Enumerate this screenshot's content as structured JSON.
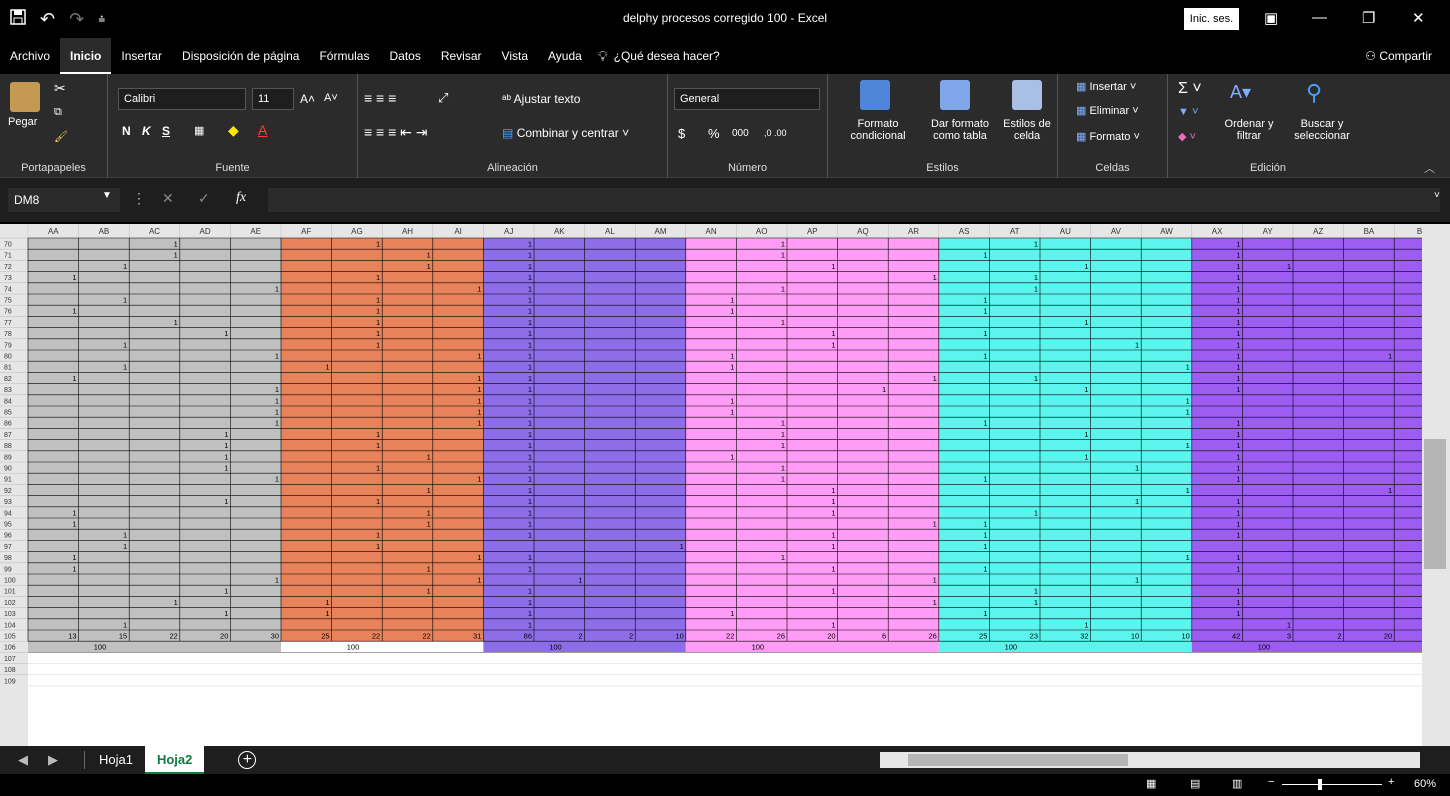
{
  "window": {
    "title": "delphy procesos corregido 100  -  Excel",
    "signin_label": "Inic. ses.",
    "quick_access": [
      "save-icon",
      "undo-icon",
      "redo-icon",
      "customize-icon"
    ]
  },
  "menu": {
    "items": [
      "Archivo",
      "Inicio",
      "Insertar",
      "Disposición de página",
      "Fórmulas",
      "Datos",
      "Revisar",
      "Vista",
      "Ayuda"
    ],
    "active": "Inicio",
    "tell_me": "¿Qué desea hacer?",
    "share": "Compartir"
  },
  "ribbon": {
    "clipboard": {
      "paste": "Pegar",
      "label": "Portapapeles"
    },
    "font": {
      "name": "Calibri",
      "size": "11",
      "bold": "N",
      "italic": "K",
      "underline": "S",
      "label": "Fuente"
    },
    "alignment": {
      "wrap": "Ajustar texto",
      "merge": "Combinar y centrar",
      "label": "Alineación"
    },
    "number": {
      "format": "General",
      "currency": "$",
      "percent": "%",
      "thousands": "000",
      "inc_dec": ",0 .00",
      "dec_dec": ",00 →,0",
      "label": "Número"
    },
    "styles": {
      "conditional": "Formato condicional",
      "table": "Dar formato como tabla",
      "cell": "Estilos de celda",
      "label": "Estilos"
    },
    "cells": {
      "insert": "Insertar",
      "delete": "Eliminar",
      "format": "Formato",
      "label": "Celdas"
    },
    "editing": {
      "sort": "Ordenar y filtrar",
      "find": "Buscar y seleccionar",
      "label": "Edición"
    }
  },
  "formula_bar": {
    "name_box": "DM8",
    "formula": "",
    "fx": "fx"
  },
  "sheet": {
    "columns": [
      "AA",
      "AB",
      "AC",
      "AD",
      "AE",
      "AF",
      "AG",
      "AH",
      "AI",
      "AJ",
      "AK",
      "AL",
      "AM",
      "AN",
      "AO",
      "AP",
      "AQ",
      "AR",
      "AS",
      "AT",
      "AU",
      "AV",
      "AW",
      "AX",
      "AY",
      "AZ",
      "BA",
      "B"
    ],
    "rows": [
      "70",
      "71",
      "72",
      "73",
      "74",
      "75",
      "76",
      "77",
      "78",
      "79",
      "80",
      "81",
      "82",
      "83",
      "84",
      "85",
      "86",
      "87",
      "88",
      "89",
      "90",
      "91",
      "92",
      "93",
      "94",
      "95",
      "96",
      "97",
      "98",
      "99",
      "100",
      "101",
      "102",
      "103",
      "104",
      "105",
      "106",
      "107",
      "108",
      "109"
    ],
    "group_colors": [
      "#c0c0c0",
      "#e8825a",
      "#8e6ee8",
      "#ff9cf5",
      "#5bf5ee",
      "#9d5cf2"
    ],
    "matrix": [
      [
        0,
        0,
        1,
        0,
        0,
        0,
        1,
        0,
        0,
        1,
        0,
        0,
        0,
        0,
        1,
        0,
        0,
        0,
        0,
        1,
        0,
        0,
        0,
        1,
        0,
        0,
        0,
        0
      ],
      [
        0,
        0,
        1,
        0,
        0,
        0,
        0,
        1,
        0,
        1,
        0,
        0,
        0,
        0,
        1,
        0,
        0,
        0,
        1,
        0,
        0,
        0,
        0,
        1,
        0,
        0,
        0,
        0
      ],
      [
        0,
        1,
        0,
        0,
        0,
        0,
        0,
        1,
        0,
        1,
        0,
        0,
        0,
        0,
        0,
        1,
        0,
        0,
        0,
        0,
        1,
        0,
        0,
        1,
        1,
        0,
        0,
        0
      ],
      [
        1,
        0,
        0,
        0,
        0,
        0,
        1,
        0,
        0,
        1,
        0,
        0,
        0,
        0,
        0,
        0,
        0,
        1,
        0,
        1,
        0,
        0,
        0,
        1,
        0,
        0,
        0,
        0
      ],
      [
        0,
        0,
        0,
        0,
        1,
        0,
        0,
        0,
        1,
        1,
        0,
        0,
        0,
        0,
        1,
        0,
        0,
        0,
        0,
        1,
        0,
        0,
        0,
        1,
        0,
        0,
        0,
        0
      ],
      [
        0,
        1,
        0,
        0,
        0,
        0,
        1,
        0,
        0,
        1,
        0,
        0,
        0,
        1,
        0,
        0,
        0,
        0,
        1,
        0,
        0,
        0,
        0,
        1,
        0,
        0,
        0,
        0
      ],
      [
        1,
        0,
        0,
        0,
        0,
        0,
        1,
        0,
        0,
        1,
        0,
        0,
        0,
        1,
        0,
        0,
        0,
        0,
        1,
        0,
        0,
        0,
        0,
        1,
        0,
        0,
        0,
        0
      ],
      [
        0,
        0,
        1,
        0,
        0,
        0,
        1,
        0,
        0,
        1,
        0,
        0,
        0,
        0,
        1,
        0,
        0,
        0,
        0,
        0,
        1,
        0,
        0,
        1,
        0,
        0,
        0,
        0
      ],
      [
        0,
        0,
        0,
        1,
        0,
        0,
        1,
        0,
        0,
        1,
        0,
        0,
        0,
        0,
        0,
        1,
        0,
        0,
        1,
        0,
        0,
        0,
        0,
        1,
        0,
        0,
        0,
        0
      ],
      [
        0,
        1,
        0,
        0,
        0,
        0,
        1,
        0,
        0,
        1,
        0,
        0,
        0,
        0,
        0,
        1,
        0,
        0,
        0,
        0,
        0,
        1,
        0,
        1,
        0,
        0,
        0,
        0
      ],
      [
        0,
        0,
        0,
        0,
        1,
        0,
        0,
        0,
        1,
        1,
        0,
        0,
        0,
        1,
        0,
        0,
        0,
        0,
        1,
        0,
        0,
        0,
        0,
        1,
        0,
        0,
        1,
        0
      ],
      [
        0,
        1,
        0,
        0,
        0,
        1,
        0,
        0,
        0,
        1,
        0,
        0,
        0,
        1,
        0,
        0,
        0,
        0,
        0,
        0,
        0,
        0,
        1,
        1,
        0,
        0,
        0,
        0
      ],
      [
        1,
        0,
        0,
        0,
        0,
        0,
        0,
        0,
        1,
        1,
        0,
        0,
        0,
        0,
        0,
        0,
        0,
        1,
        0,
        1,
        0,
        0,
        0,
        1,
        0,
        0,
        0,
        0
      ],
      [
        0,
        0,
        0,
        0,
        1,
        0,
        0,
        0,
        1,
        1,
        0,
        0,
        0,
        0,
        0,
        0,
        1,
        0,
        0,
        0,
        1,
        0,
        0,
        1,
        0,
        0,
        0,
        0
      ],
      [
        0,
        0,
        0,
        0,
        1,
        0,
        0,
        0,
        1,
        1,
        0,
        0,
        0,
        1,
        0,
        0,
        0,
        0,
        0,
        0,
        0,
        0,
        1,
        0,
        0,
        0,
        0,
        0
      ],
      [
        0,
        0,
        0,
        0,
        1,
        0,
        0,
        0,
        1,
        1,
        0,
        0,
        0,
        1,
        0,
        0,
        0,
        0,
        0,
        0,
        0,
        0,
        1,
        0,
        0,
        0,
        0,
        0
      ],
      [
        0,
        0,
        0,
        0,
        1,
        0,
        0,
        0,
        1,
        1,
        0,
        0,
        0,
        0,
        1,
        0,
        0,
        0,
        1,
        0,
        0,
        0,
        0,
        1,
        0,
        0,
        0,
        0
      ],
      [
        0,
        0,
        0,
        1,
        0,
        0,
        1,
        0,
        0,
        1,
        0,
        0,
        0,
        0,
        1,
        0,
        0,
        0,
        0,
        0,
        1,
        0,
        0,
        1,
        0,
        0,
        0,
        0
      ],
      [
        0,
        0,
        0,
        1,
        0,
        0,
        1,
        0,
        0,
        1,
        0,
        0,
        0,
        0,
        1,
        0,
        0,
        0,
        0,
        0,
        0,
        0,
        1,
        1,
        0,
        0,
        0,
        0
      ],
      [
        0,
        0,
        0,
        1,
        0,
        0,
        0,
        1,
        0,
        1,
        0,
        0,
        0,
        1,
        0,
        0,
        0,
        0,
        0,
        0,
        1,
        0,
        0,
        1,
        0,
        0,
        0,
        0
      ],
      [
        0,
        0,
        0,
        1,
        0,
        0,
        1,
        0,
        0,
        1,
        0,
        0,
        0,
        0,
        1,
        0,
        0,
        0,
        0,
        0,
        0,
        1,
        0,
        1,
        0,
        0,
        0,
        0
      ],
      [
        0,
        0,
        0,
        0,
        1,
        0,
        0,
        0,
        1,
        1,
        0,
        0,
        0,
        0,
        1,
        0,
        0,
        0,
        1,
        0,
        0,
        0,
        0,
        1,
        0,
        0,
        0,
        0
      ],
      [
        0,
        0,
        0,
        0,
        0,
        0,
        0,
        1,
        0,
        1,
        0,
        0,
        0,
        0,
        0,
        1,
        0,
        0,
        0,
        0,
        0,
        0,
        1,
        0,
        0,
        0,
        1,
        0
      ],
      [
        0,
        0,
        0,
        1,
        0,
        0,
        1,
        0,
        0,
        1,
        0,
        0,
        0,
        0,
        0,
        1,
        0,
        0,
        0,
        0,
        0,
        1,
        0,
        1,
        0,
        0,
        0,
        0
      ],
      [
        1,
        0,
        0,
        0,
        0,
        0,
        0,
        1,
        0,
        1,
        0,
        0,
        0,
        0,
        0,
        1,
        0,
        0,
        0,
        1,
        0,
        0,
        0,
        1,
        0,
        0,
        0,
        0
      ],
      [
        1,
        0,
        0,
        0,
        0,
        0,
        0,
        1,
        0,
        1,
        0,
        0,
        0,
        0,
        0,
        0,
        0,
        1,
        1,
        0,
        0,
        0,
        0,
        1,
        0,
        0,
        0,
        0
      ],
      [
        0,
        1,
        0,
        0,
        0,
        0,
        1,
        0,
        0,
        1,
        0,
        0,
        0,
        0,
        0,
        1,
        0,
        0,
        1,
        0,
        0,
        0,
        0,
        1,
        0,
        0,
        0,
        0
      ],
      [
        0,
        1,
        0,
        0,
        0,
        0,
        1,
        0,
        0,
        0,
        0,
        0,
        1,
        0,
        0,
        1,
        0,
        0,
        1,
        0,
        0,
        0,
        0,
        0,
        0,
        0,
        0,
        0
      ],
      [
        1,
        0,
        0,
        0,
        0,
        0,
        0,
        0,
        1,
        1,
        0,
        0,
        0,
        0,
        1,
        0,
        0,
        0,
        0,
        0,
        0,
        0,
        1,
        1,
        0,
        0,
        0,
        0
      ],
      [
        1,
        0,
        0,
        0,
        0,
        0,
        0,
        1,
        0,
        1,
        0,
        0,
        0,
        0,
        0,
        1,
        0,
        0,
        1,
        0,
        0,
        0,
        0,
        1,
        0,
        0,
        0,
        0
      ],
      [
        0,
        0,
        0,
        0,
        1,
        0,
        0,
        0,
        1,
        0,
        1,
        0,
        0,
        0,
        0,
        0,
        0,
        1,
        0,
        0,
        0,
        1,
        0,
        0,
        0,
        0,
        0,
        0
      ],
      [
        0,
        0,
        0,
        1,
        0,
        0,
        0,
        1,
        0,
        1,
        0,
        0,
        0,
        0,
        0,
        1,
        0,
        0,
        0,
        1,
        0,
        0,
        0,
        1,
        0,
        0,
        0,
        0
      ],
      [
        0,
        0,
        1,
        0,
        0,
        1,
        0,
        0,
        0,
        1,
        0,
        0,
        0,
        0,
        0,
        0,
        0,
        1,
        0,
        1,
        0,
        0,
        0,
        1,
        0,
        0,
        0,
        0
      ],
      [
        0,
        0,
        0,
        1,
        0,
        1,
        0,
        0,
        0,
        1,
        0,
        0,
        0,
        1,
        0,
        0,
        0,
        0,
        1,
        0,
        0,
        0,
        0,
        1,
        0,
        0,
        0,
        0
      ],
      [
        0,
        1,
        0,
        0,
        0,
        0,
        0,
        0,
        0,
        1,
        0,
        0,
        0,
        0,
        0,
        1,
        0,
        0,
        0,
        0,
        1,
        0,
        0,
        0,
        1,
        0,
        0,
        0
      ]
    ],
    "totals": [
      "13",
      "15",
      "22",
      "20",
      "30",
      "25",
      "22",
      "22",
      "31",
      "86",
      "2",
      "2",
      "10",
      "22",
      "26",
      "20",
      "6",
      "26",
      "25",
      "23",
      "32",
      "10",
      "10",
      "42",
      "3",
      "2",
      "20",
      ""
    ],
    "group_totals": [
      "100",
      "100",
      "100",
      "100",
      "100",
      "100"
    ]
  },
  "tabs": {
    "sheets": [
      "Hoja1",
      "Hoja2"
    ],
    "active": "Hoja2",
    "add": "+"
  },
  "status": {
    "zoom": "60%"
  }
}
